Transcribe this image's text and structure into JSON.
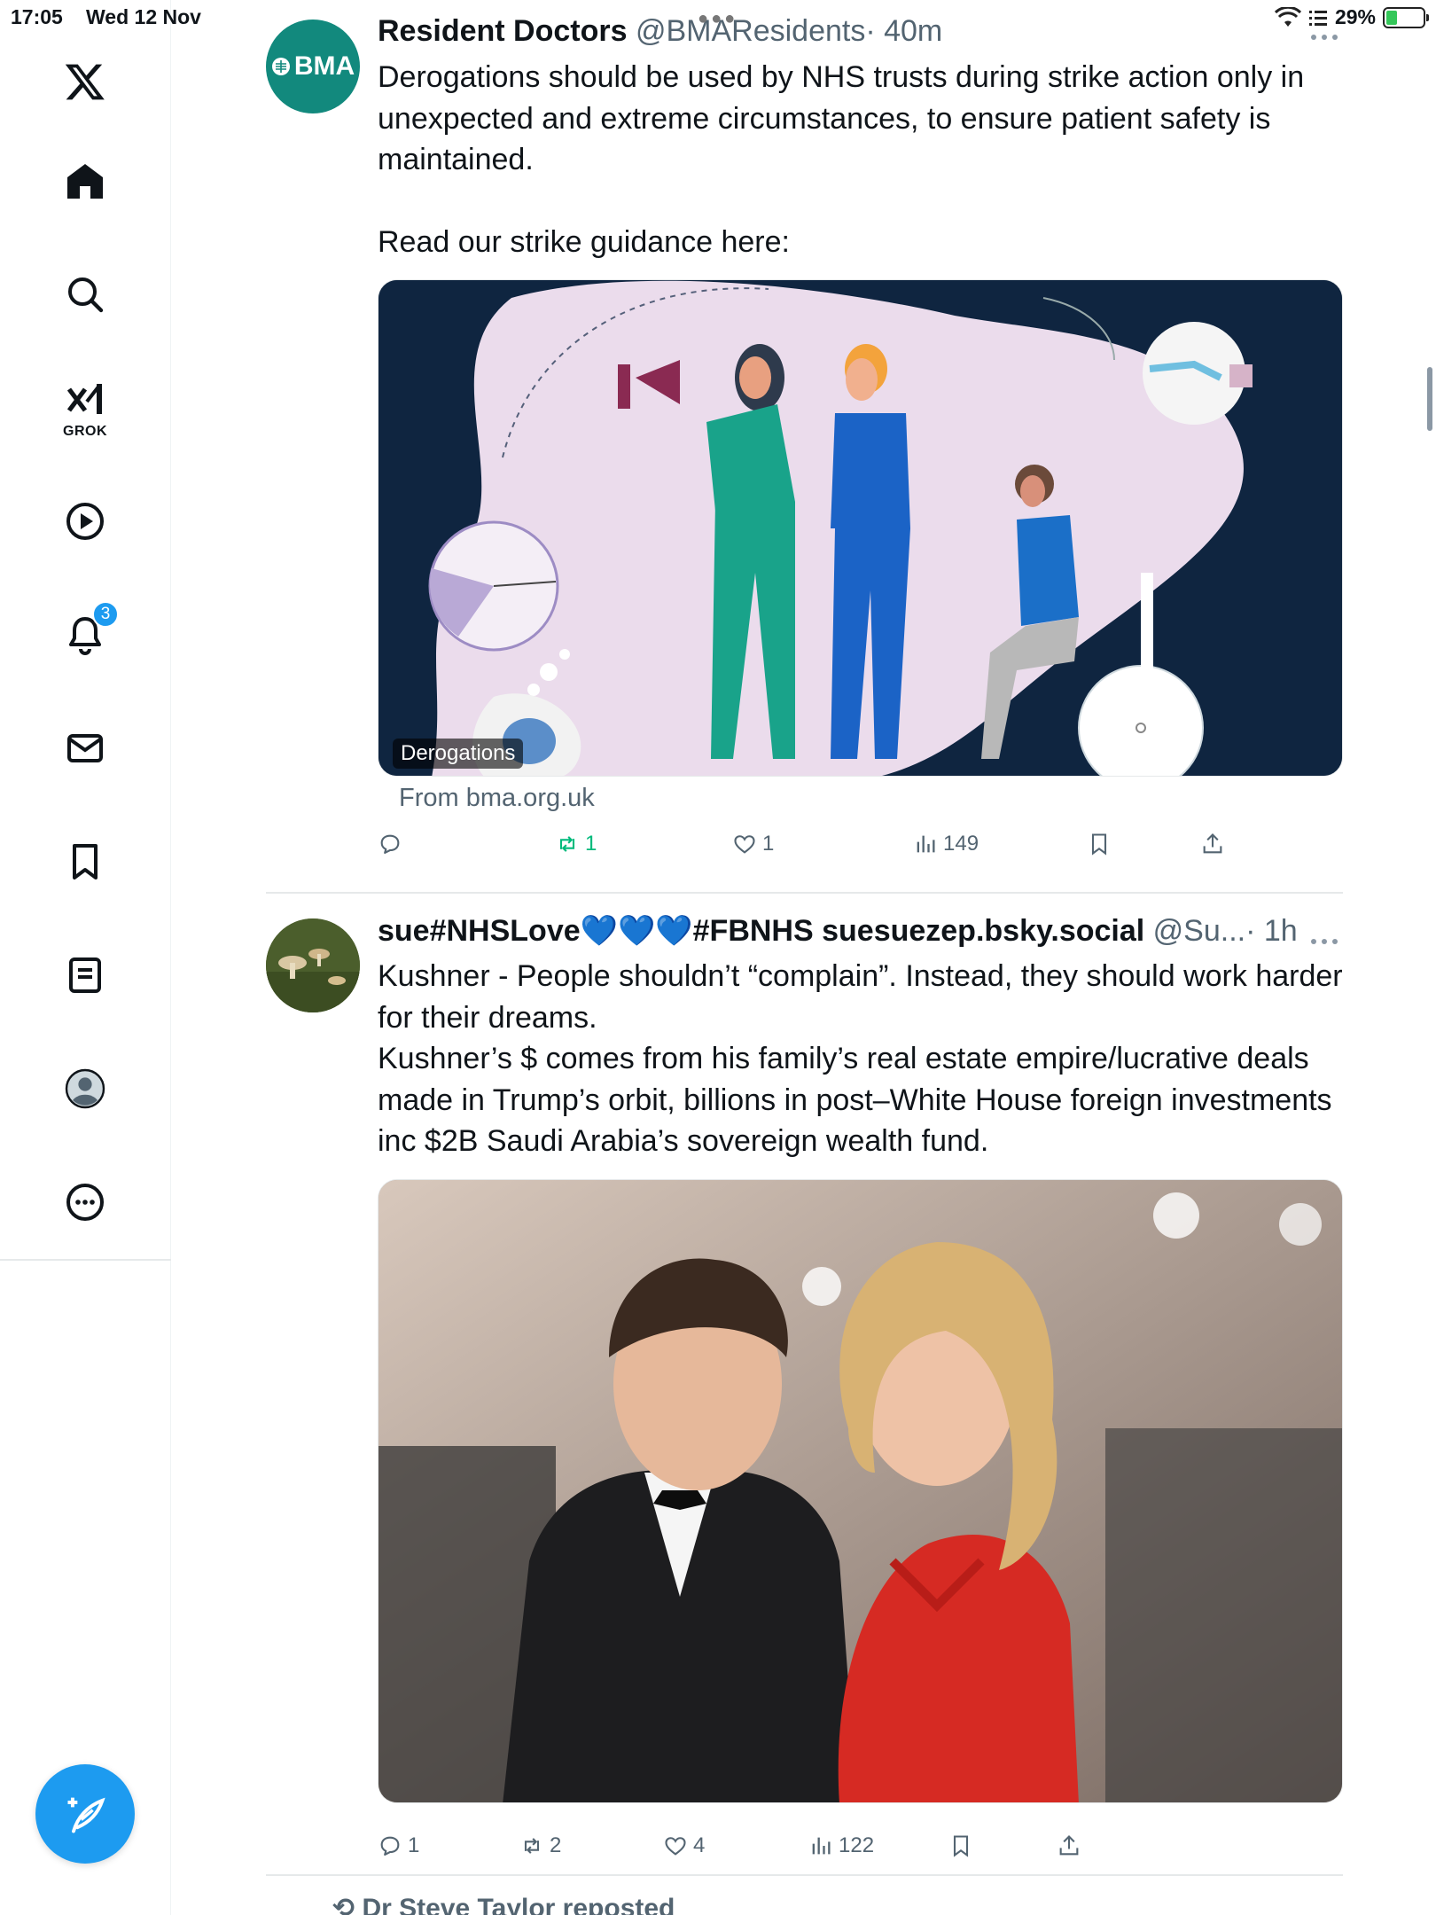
{
  "status_bar": {
    "time": "17:05",
    "date": "Wed 12 Nov",
    "battery": "29%",
    "battery_level": 0.29
  },
  "sidebar": {
    "items": [
      {
        "name": "x-logo-icon"
      },
      {
        "name": "home-icon"
      },
      {
        "name": "search-icon"
      },
      {
        "name": "grok-icon",
        "label": "GROK"
      },
      {
        "name": "video-play-icon"
      },
      {
        "name": "notifications-bell-icon",
        "badge": "3"
      },
      {
        "name": "messages-mail-icon"
      },
      {
        "name": "bookmark-icon"
      },
      {
        "name": "lists-icon"
      },
      {
        "name": "profile-icon"
      },
      {
        "name": "more-options-icon"
      }
    ],
    "compose_icon": "compose-feather-icon"
  },
  "tweets": [
    {
      "display_name": "Resident Doctors",
      "handle": "@BMAResidents",
      "time": "· 40m",
      "avatar_text": "BMA",
      "text": "Derogations should be used by NHS trusts during strike action only in unexpected and extreme circumstances, to ensure patient safety is maintained.\n\nRead our strike guidance here:",
      "card_label": "Derogations",
      "card_source": "From bma.org.uk",
      "replies": "",
      "reposts": "1",
      "likes": "1",
      "views": "149"
    },
    {
      "display_name": "sue#NHSLove💙💙💙#FBNHS suesuezep.bsky.social",
      "handle": "@Su...",
      "time": "· 1h",
      "text": "Kushner - People shouldn’t “complain”. Instead, they should work harder for their dreams.\nKushner’s $ comes from his family’s real estate empire/lucrative deals made in Trump’s orbit, billions in post–White House foreign investments inc $2B Saudi Arabia’s sovereign wealth fund.",
      "replies": "1",
      "reposts": "2",
      "likes": "4",
      "views": "122"
    }
  ],
  "next_tweet_repost_note": "Dr Steve Taylor reposted",
  "colors": {
    "accent": "#1d9bf0",
    "bma_green": "#12897d",
    "retweet_green": "#00ba7c",
    "card_bg": "#0f2540",
    "card_blob": "#ebdcec"
  }
}
